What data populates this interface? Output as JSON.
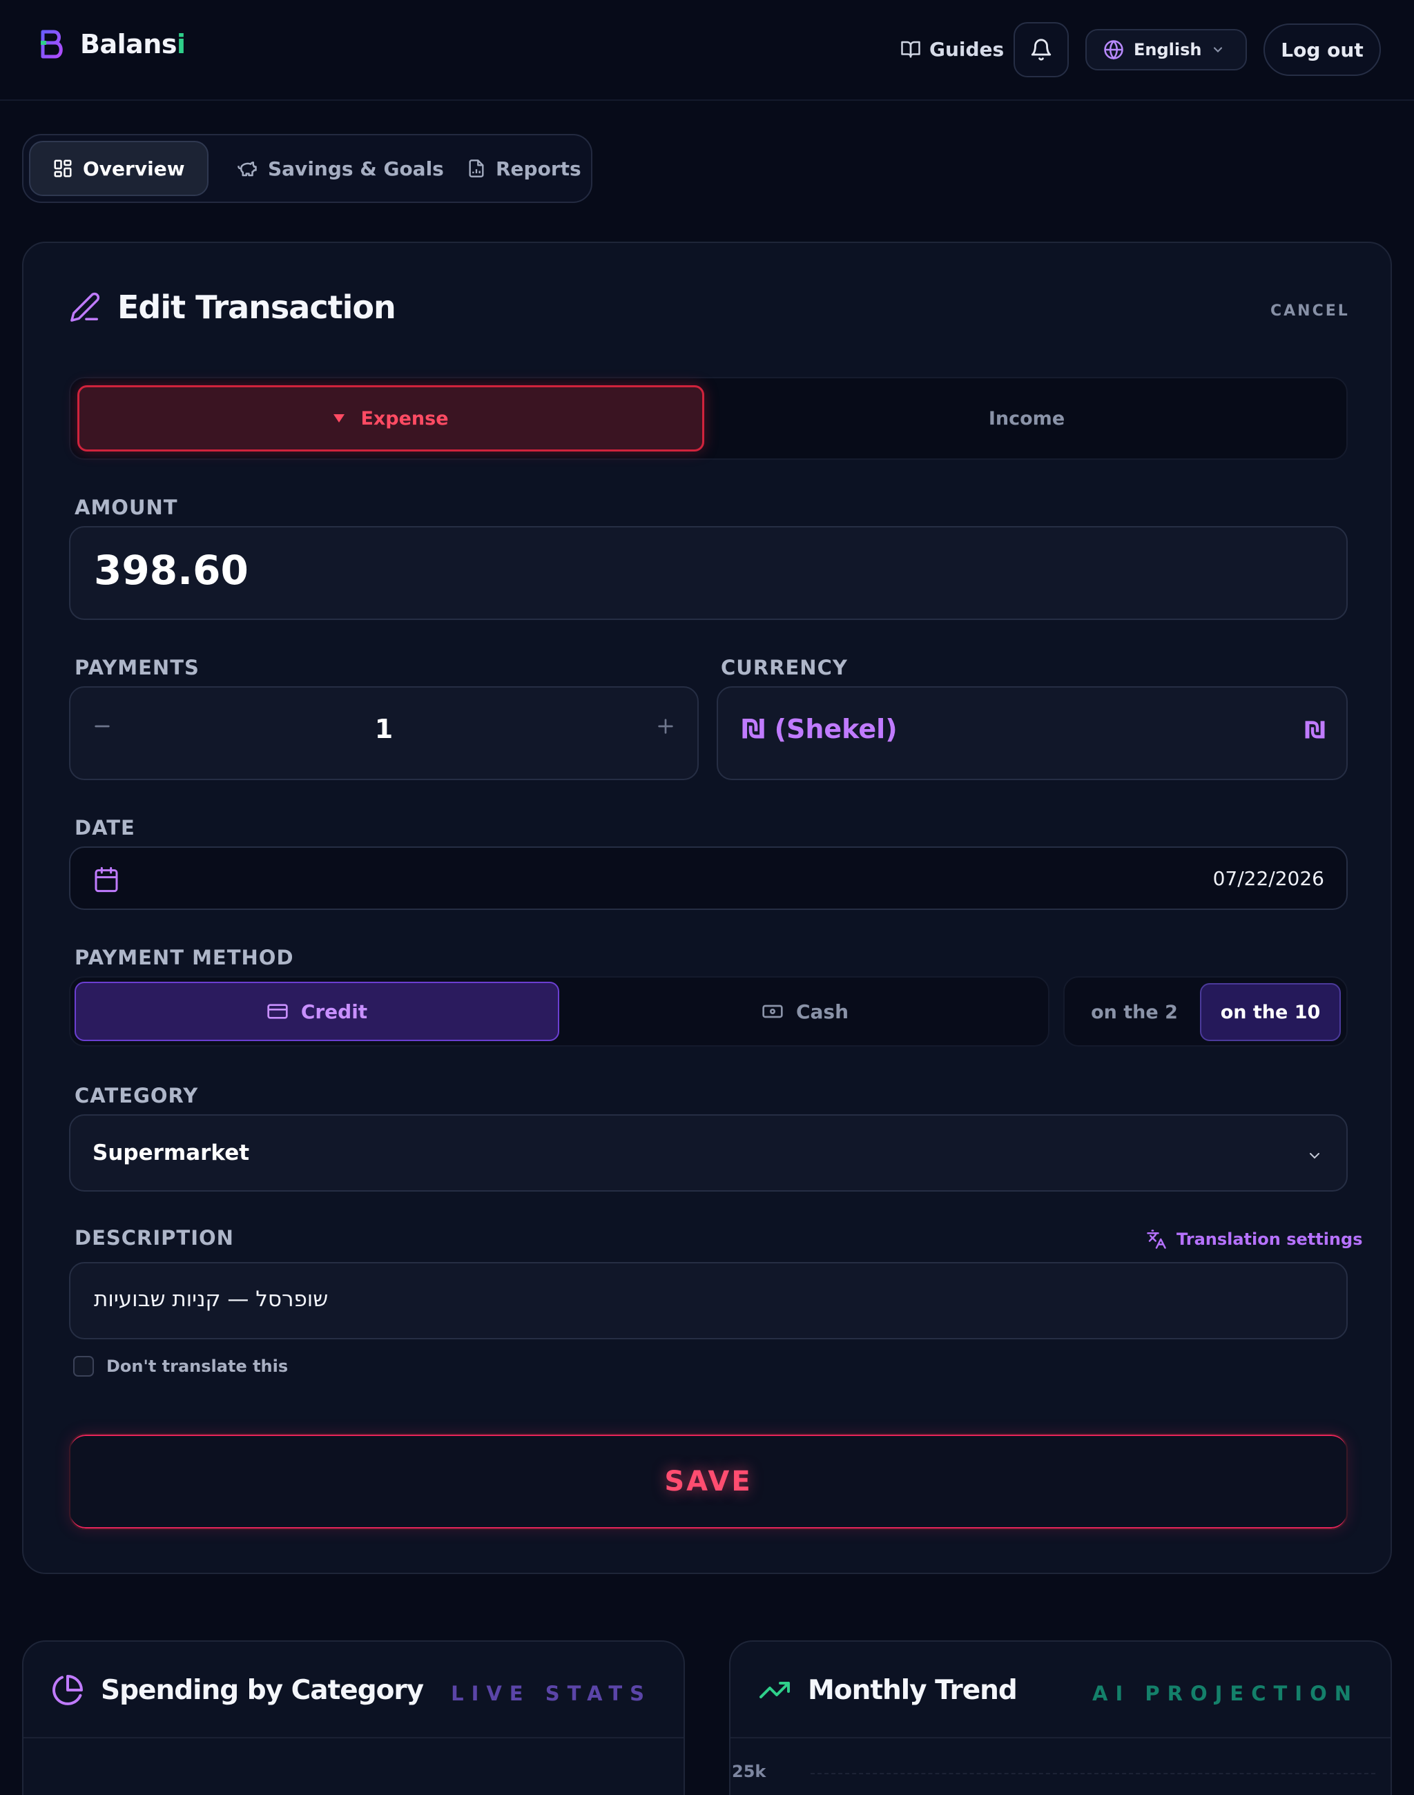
{
  "header": {
    "app_name_main": "Balans",
    "app_name_accent": "i",
    "guides_label": "Guides",
    "language_label": "English",
    "logout_label": "Log out"
  },
  "tabs": [
    {
      "label": "Overview",
      "icon": "grid-icon",
      "active": true
    },
    {
      "label": "Savings & Goals",
      "icon": "piggy-bank-icon",
      "active": false
    },
    {
      "label": "Reports",
      "icon": "report-icon",
      "active": false
    }
  ],
  "edit_form": {
    "title": "Edit Transaction",
    "cancel_label": "CANCEL",
    "type_toggle": {
      "expense_label": "Expense",
      "income_label": "Income",
      "selected": "Expense"
    },
    "amount": {
      "label": "AMOUNT",
      "value": "398.60"
    },
    "payments": {
      "label": "PAYMENTS",
      "value": "1"
    },
    "currency": {
      "label": "CURRENCY",
      "value": "₪ (Shekel)",
      "symbol": "₪"
    },
    "date": {
      "label": "DATE",
      "value": "07/22/2026"
    },
    "payment_method": {
      "label": "PAYMENT METHOD",
      "credit_label": "Credit",
      "cash_label": "Cash",
      "selected": "Credit",
      "billing_day_2": "on the 2",
      "billing_day_10": "on the 10",
      "billing_selected": "on the 10"
    },
    "category": {
      "label": "CATEGORY",
      "value": "Supermarket"
    },
    "description": {
      "label": "DESCRIPTION",
      "translation_settings_label": "Translation settings",
      "value": "שופרסל — קניות שבועיות"
    },
    "dont_translate": {
      "label": "Don't translate this",
      "checked": false
    },
    "save_label": "SAVE"
  },
  "spending_card": {
    "title": "Spending by Category",
    "badge": "LIVE STATS"
  },
  "trend_card": {
    "title": "Monthly Trend",
    "badge": "AI PROJECTION",
    "y_tick_top": "25k"
  },
  "colors": {
    "background": "#070b19",
    "card": "#0c1223",
    "expense_red": "#ff4b63",
    "save_pink": "#ff4d70",
    "accent_purple": "#c07bff",
    "brand_green": "#2fd08a",
    "ai_teal": "#14806a"
  }
}
